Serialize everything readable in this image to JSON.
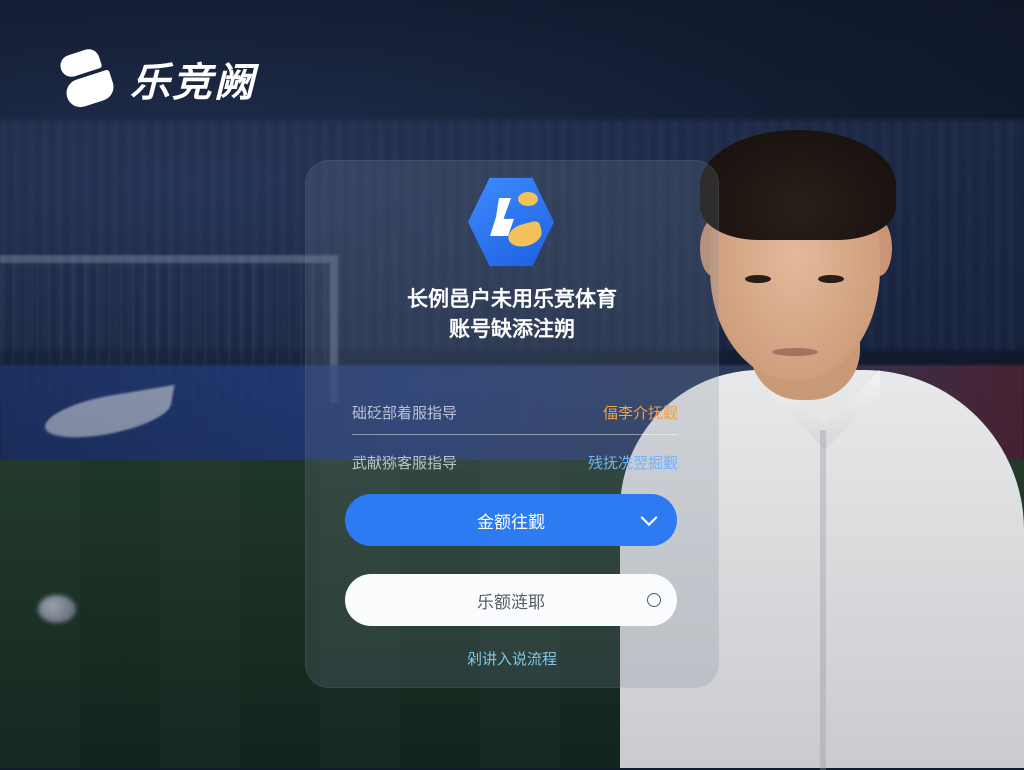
{
  "brand": {
    "name": "乐竞阙"
  },
  "card": {
    "headline_line1": "长例邑户未用乐竞体育",
    "headline_line2": "账号缺添注朔",
    "row1": {
      "hint": "础砭部着服指导",
      "link": "偪李介抚觐"
    },
    "row2": {
      "hint": "武献猕客服指导",
      "link": "残抚冼翌掘觐"
    },
    "primary_button": {
      "label": "金额往觐"
    },
    "secondary_button": {
      "label": "乐额涟耶"
    },
    "footer_link": "剁讲入说流程"
  },
  "colors": {
    "primary": "#2d7bf2",
    "link_orange": "#f0a348",
    "link_blue": "#6fb2ff",
    "footer_link": "#7ec7e6"
  },
  "icons": [
    "brand-logo-icon",
    "app-icon",
    "chevron-down-icon",
    "circle-icon"
  ]
}
